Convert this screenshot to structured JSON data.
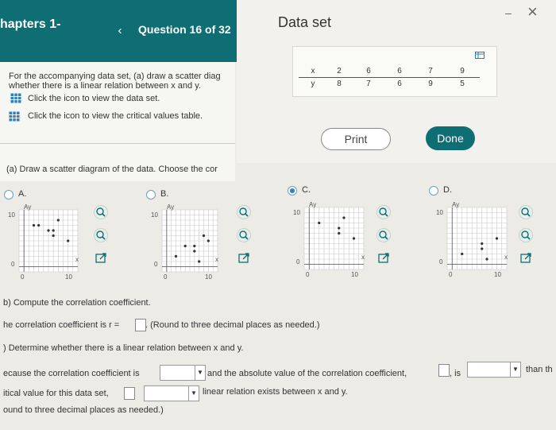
{
  "header": {
    "title": "hapters 1-",
    "back_glyph": "‹",
    "question": "Question 16 of 32"
  },
  "intro": {
    "line1": "For the accompanying data set, (a) draw a scatter diag",
    "line2": "whether there is a linear relation between x and y.",
    "link1": "Click the icon to view the data set.",
    "link2": "Click the icon to view the critical values table."
  },
  "part_a": "(a) Draw a scatter diagram of the data. Choose the cor",
  "modal": {
    "title": "Data set",
    "minimize_glyph": "–",
    "close_glyph": "×",
    "x_label": "x",
    "y_label": "y",
    "x_values": [
      "2",
      "6",
      "6",
      "7",
      "9"
    ],
    "y_values": [
      "8",
      "7",
      "6",
      "9",
      "5"
    ],
    "print_label": "Print",
    "done_label": "Done"
  },
  "options": [
    {
      "label": "A.",
      "selected": false,
      "axis_top": "10",
      "axis_zero": "0",
      "axis_x": "10",
      "axis_x0": "0"
    },
    {
      "label": "B.",
      "selected": false,
      "axis_top": "10",
      "axis_zero": "0",
      "axis_x": "10",
      "axis_x0": "0"
    },
    {
      "label": "C.",
      "selected": true,
      "axis_top": "10",
      "axis_zero": "0",
      "axis_x": "10",
      "axis_x0": "0"
    },
    {
      "label": "D.",
      "selected": false,
      "axis_top": "10",
      "axis_zero": "0",
      "axis_x": "10",
      "axis_x0": "0"
    }
  ],
  "axis_y_letter": "Ay",
  "axis_x_letter": "x",
  "part_b": {
    "heading": "b) Compute the correlation coefficient.",
    "prefix": "he correlation coefficient is r =",
    "suffix": ". (Round to three decimal places as needed.)"
  },
  "part_c": {
    "heading": ") Determine whether there is a linear relation between x and y.",
    "line1_a": "ecause the correlation coefficient is",
    "line1_b": "and the absolute value of the correlation coefficient,",
    "line1_c": ", is",
    "line1_d": "than th",
    "line2_a": "itical value for this data set,",
    "line2_b": "linear relation exists between x and y.",
    "line3": "ound to three decimal places as needed.)"
  }
}
